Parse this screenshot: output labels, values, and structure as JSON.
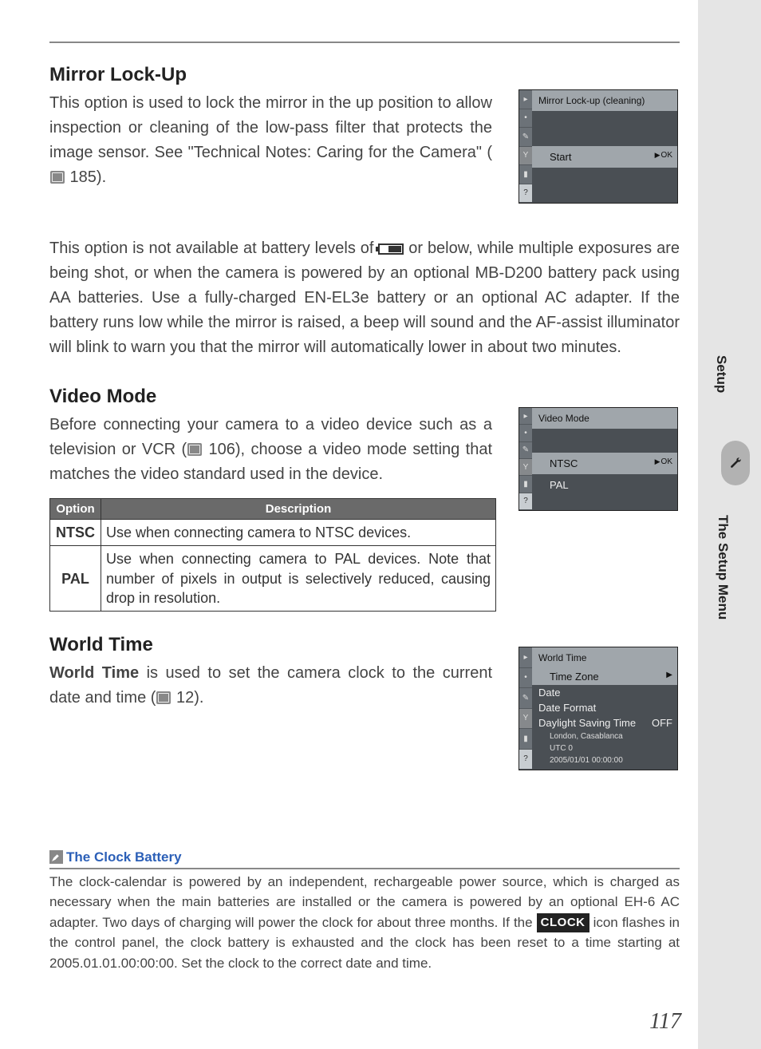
{
  "sections": {
    "mirror": {
      "heading": "Mirror Lock-Up",
      "p1a": "This option is used to lock the mirror in the up position to allow inspection or cleaning of the low-pass filter that protects the image sensor.  See \"Technical Notes: Caring for the Camera\" (",
      "p1_ref": " 185).",
      "p2a": "This option is not available at battery levels of ",
      "p2b": " or below, while multiple exposures are being shot, or when the camera is powered by an optional MB-D200 battery pack using AA batteries.  Use a fully-charged EN-EL3e battery or an optional AC adapter.  If the battery runs low while the mirror is raised, a beep will sound and the AF-assist illuminator will blink to warn you that the mirror will automatically lower in about two minutes."
    },
    "video": {
      "heading": "Video Mode",
      "p1a": "Before connecting your camera to a video device such as a television or VCR (",
      "p1_ref": " 106), choose a video mode setting that matches the video standard used in the device.",
      "table": {
        "h_option": "Option",
        "h_desc": "Description",
        "rows": [
          {
            "opt": "NTSC",
            "desc": "Use when connecting camera to NTSC devices."
          },
          {
            "opt": "PAL",
            "desc": "Use when connecting camera to PAL devices.  Note that number of pixels in output is selectively reduced, causing drop in resolution."
          }
        ]
      }
    },
    "world": {
      "heading": "World Time",
      "p1_bold": "World Time",
      "p1a": " is used to set the camera clock to the current date and time (",
      "p1_ref": " 12)."
    }
  },
  "lcd": {
    "mirror": {
      "title": "Mirror Lock-up (cleaning)",
      "item": "Start",
      "ok": "OK"
    },
    "video": {
      "title": "Video Mode",
      "items": [
        "NTSC",
        "PAL"
      ],
      "ok": "OK"
    },
    "world": {
      "title": "World Time",
      "items": [
        "Time Zone",
        "Date",
        "Date Format"
      ],
      "dst": "Daylight Saving Time",
      "dst_val": "OFF",
      "tz": "London, Casablanca",
      "utc": "UTC 0",
      "ts": "2005/01/01 00:00:00"
    }
  },
  "note": {
    "title": "The Clock Battery",
    "body_a": "The clock-calendar is powered by an independent, rechargeable power source, which is charged as necessary when the main batteries are installed or the camera is powered by an optional EH-6 AC adapter.  Two days of charging will power the clock for about three months.  If the ",
    "clock_badge": "CLOCK",
    "body_b": " icon flashes in the control panel, the clock battery is exhausted and the clock has been reset to a time starting at 2005.01.01.00:00:00.  Set the clock to the correct date and time."
  },
  "side": {
    "setup": "Setup",
    "menu": "The Setup Menu"
  },
  "page_number": "117"
}
